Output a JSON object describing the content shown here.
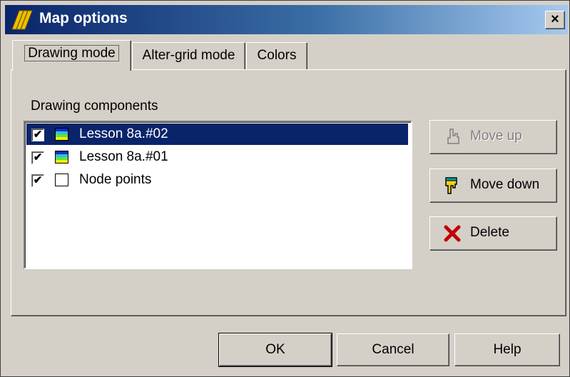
{
  "window": {
    "title": "Map options",
    "close_glyph": "×"
  },
  "tabs": [
    {
      "label": "Drawing mode",
      "active": true
    },
    {
      "label": "Alter-grid mode",
      "active": false
    },
    {
      "label": "Colors",
      "active": false
    }
  ],
  "drawing": {
    "group_label": "Drawing components",
    "items": [
      {
        "label": "Lesson 8a.#02",
        "checked": true,
        "selected": true,
        "check_glyph": "✔",
        "icon": "colormap-swatch-icon"
      },
      {
        "label": "Lesson 8a.#01",
        "checked": true,
        "selected": false,
        "check_glyph": "✔",
        "icon": "colormap-swatch-icon"
      },
      {
        "label": "Node points",
        "checked": true,
        "selected": false,
        "check_glyph": "✔",
        "icon": "empty-swatch-icon"
      }
    ],
    "move_up_label": "Move up",
    "move_down_label": "Move down",
    "delete_label": "Delete"
  },
  "footer": {
    "ok_label": "OK",
    "cancel_label": "Cancel",
    "help_label": "Help"
  },
  "colors": {
    "title_start": "#0a246a",
    "title_end": "#a6caf0",
    "selection": "#0a246a",
    "face": "#d4d0c8",
    "delete_x": "#c00000"
  }
}
